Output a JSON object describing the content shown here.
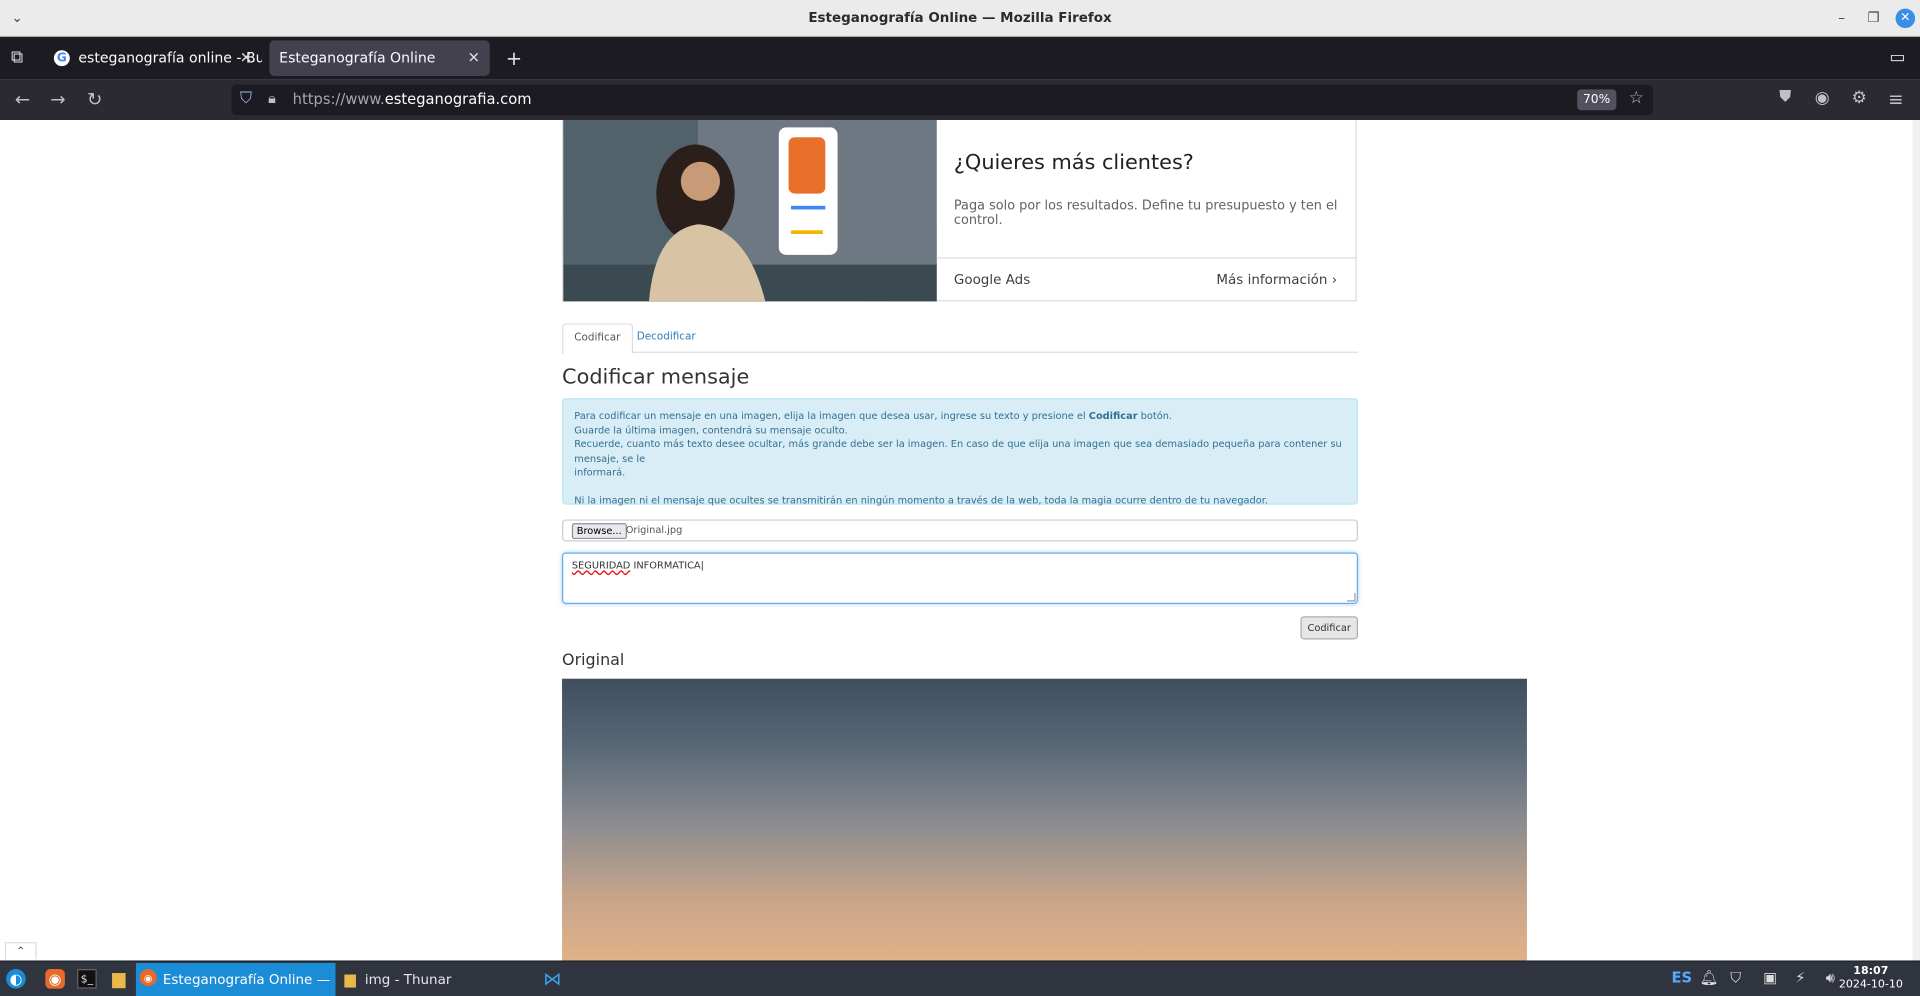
{
  "window": {
    "title": "Esteganografía Online — Mozilla Firefox"
  },
  "tabs": [
    {
      "label": "esteganografía online - Busc",
      "active": false
    },
    {
      "label": "Esteganografía Online",
      "active": true
    }
  ],
  "navbar": {
    "url_prefix": "https://www.",
    "url_domain": "esteganografia.com",
    "zoom": "70%"
  },
  "ad": {
    "headline": "¿Quieres más clientes?",
    "description": "Paga solo por los resultados. Define tu presupuesto y ten el control.",
    "brand": "Google Ads",
    "cta": "Más información"
  },
  "page": {
    "tabs": [
      "Codificar",
      "Decodificar"
    ],
    "section_title": "Codificar mensaje",
    "alert_lines": [
      "Para codificar un mensaje en una imagen, elija la imagen que desea usar, ingrese su texto y presione el",
      "Codificar",
      "botón.",
      "Guarde la última imagen, contendrá su mensaje oculto.",
      "Recuerde, cuanto más texto desee ocultar, más grande debe ser la imagen. En caso de que elija una imagen que sea demasiado pequeña para contener su mensaje, se le",
      "informará.",
      "Ni la imagen ni el mensaje que ocultes se transmitirán en ningún momento a través de la web, toda la magia ocurre dentro de tu navegador."
    ],
    "browse_label": "Browse...",
    "file_name": "Original.jpg",
    "message_word1": "SEGURIDAD",
    "message_word2": "INFORMATICA",
    "encode_button": "Codificar",
    "original_title": "Original"
  },
  "taskbar": {
    "windows": [
      "Esteganografía Online — ...",
      "img - Thunar"
    ],
    "keyboard_layout": "ES",
    "time": "18:07",
    "date": "2024-10-10"
  }
}
